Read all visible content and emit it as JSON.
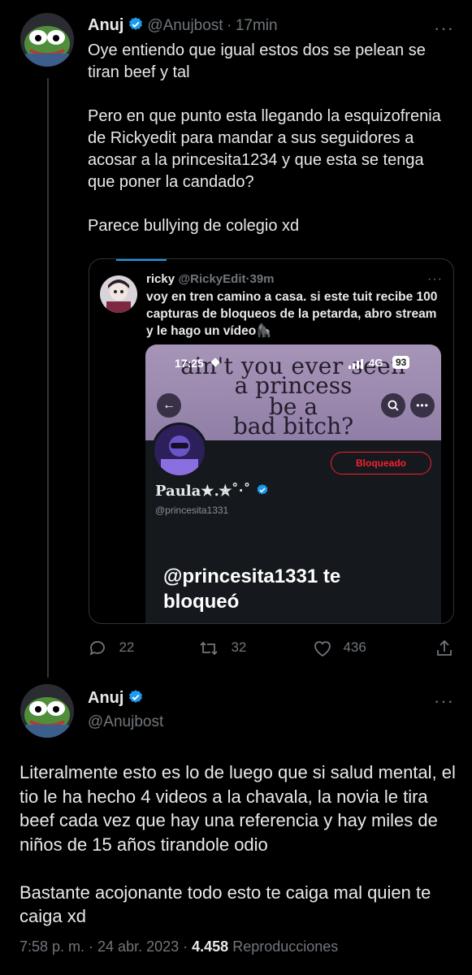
{
  "tweet1": {
    "author_name": "Anuj",
    "handle": "@Anujbost",
    "separator": "·",
    "time": "17min",
    "more": "···",
    "text": "Oye entiendo que igual estos dos se pelean se tiran beef y tal\n\nPero en que punto esta llegando la esquizofrenia de Rickyedit para mandar a sus seguidores a acosar a la princesita1234 y que esta se tenga que poner la candado?\n\nParece bullying de colegio xd"
  },
  "quote": {
    "author_name": "ricky",
    "handle": "@RickyEdit",
    "separator": "·",
    "time": "39m",
    "more": "···",
    "text": "voy en tren camino a casa. si este tuit recibe 100 capturas de bloqueos de la petarda, abro stream y le hago un vídeo🦍",
    "image": {
      "status_time": "17:25",
      "network": "4G",
      "battery": "93",
      "banner_lines": [
        "ain't you ever seen",
        "a princess",
        "be a",
        "bad bitch?"
      ],
      "blocked_label": "Bloqueado",
      "profile_name": "Paula★.✯˚‧˚",
      "profile_handle": "@princesita1331",
      "blocked_message_line1": "@princesita1331 te",
      "blocked_message_line2": "bloqueó"
    }
  },
  "actions": {
    "replies": "22",
    "retweets": "32",
    "likes": "436"
  },
  "tweet2": {
    "author_name": "Anuj",
    "handle": "@Anujbost",
    "more": "···",
    "text": "Literalmente esto es lo de luego que si salud mental, el tio le ha hecho 4 videos a la chavala, la novia le tira beef cada vez que hay una referencia y hay miles de niños de 15 años tirandole odio\n\nBastante acojonante todo esto te caiga mal quien te caiga xd",
    "timestamp": "7:58 p. m. · 24 abr. 2023 ·",
    "views_count": "4.458",
    "views_label": "Reproducciones"
  },
  "colors": {
    "background": "#000000",
    "text": "#e7e9ea",
    "muted": "#71767b",
    "verified": "#1d9bf0",
    "blocked_red": "#f4212e"
  }
}
